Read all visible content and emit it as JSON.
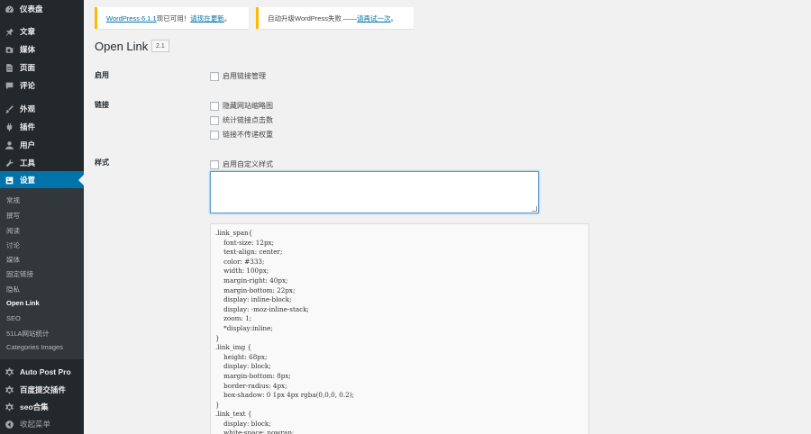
{
  "sidebar": {
    "items": [
      {
        "label": "仪表盘",
        "icon": "dashboard-icon"
      },
      {
        "label": "文章",
        "icon": "pin-icon"
      },
      {
        "label": "媒体",
        "icon": "media-icon"
      },
      {
        "label": "页面",
        "icon": "page-icon"
      },
      {
        "label": "评论",
        "icon": "comment-icon"
      },
      {
        "label": "外观",
        "icon": "brush-icon"
      },
      {
        "label": "插件",
        "icon": "plugin-icon"
      },
      {
        "label": "用户",
        "icon": "user-icon"
      },
      {
        "label": "工具",
        "icon": "wrench-icon"
      },
      {
        "label": "设置",
        "icon": "settings-icon",
        "active": true
      }
    ],
    "submenu": [
      "常规",
      "撰写",
      "阅读",
      "讨论",
      "媒体",
      "固定链接",
      "隐私",
      "Open Link",
      "SEO",
      "51LA网站统计",
      "Categories Images"
    ],
    "submenu_current": "Open Link",
    "bottom_items": [
      {
        "label": "Auto Post Pro",
        "icon": "gear-icon"
      },
      {
        "label": "百度提交插件",
        "icon": "gear-icon"
      },
      {
        "label": "seo合集",
        "icon": "gear-icon"
      },
      {
        "label": "收起菜单",
        "icon": "collapse-icon"
      }
    ],
    "accent_color": "#0073aa",
    "bg_color": "#23282d"
  },
  "notices": {
    "update": {
      "link": "WordPress 6.1.1",
      "text": "现已可用！",
      "action": "请现在更新",
      "end": "。"
    },
    "failed": {
      "text": "自动升级WordPress失败 —— ",
      "action": "请再试一次",
      "end": "。"
    }
  },
  "page": {
    "title": "Open Link",
    "version": "2.1"
  },
  "settings": {
    "enable": {
      "label": "启用",
      "options": [
        "启用链接管理"
      ]
    },
    "link": {
      "label": "链接",
      "options": [
        "隐藏网站缩略图",
        "统计链接点击数",
        "链接不传递权重"
      ]
    },
    "style": {
      "label": "样式",
      "options": [
        "启用自定义样式"
      ]
    }
  },
  "code_lines": [
    ".link_span{",
    "    font-size: 12px;",
    "    text-align: center;",
    "    color: #333;",
    "    width: 100px;",
    "    margin-right: 40px;",
    "    margin-bottom: 22px;",
    "    display: inline-block;",
    "    display: -moz-inline-stack;",
    "    zoom: 1;",
    "    *display:inline;",
    "}",
    ".link_img {",
    "    height: 68px;",
    "    display: block;",
    "    margin-bottom: 8px;",
    "    border-radius: 4px;",
    "    box-shadow: 0 1px 4px rgba(0,0,0, 0.2);",
    "}",
    ".link_text {",
    "    display: block;",
    "    white-space: nowrap;"
  ]
}
